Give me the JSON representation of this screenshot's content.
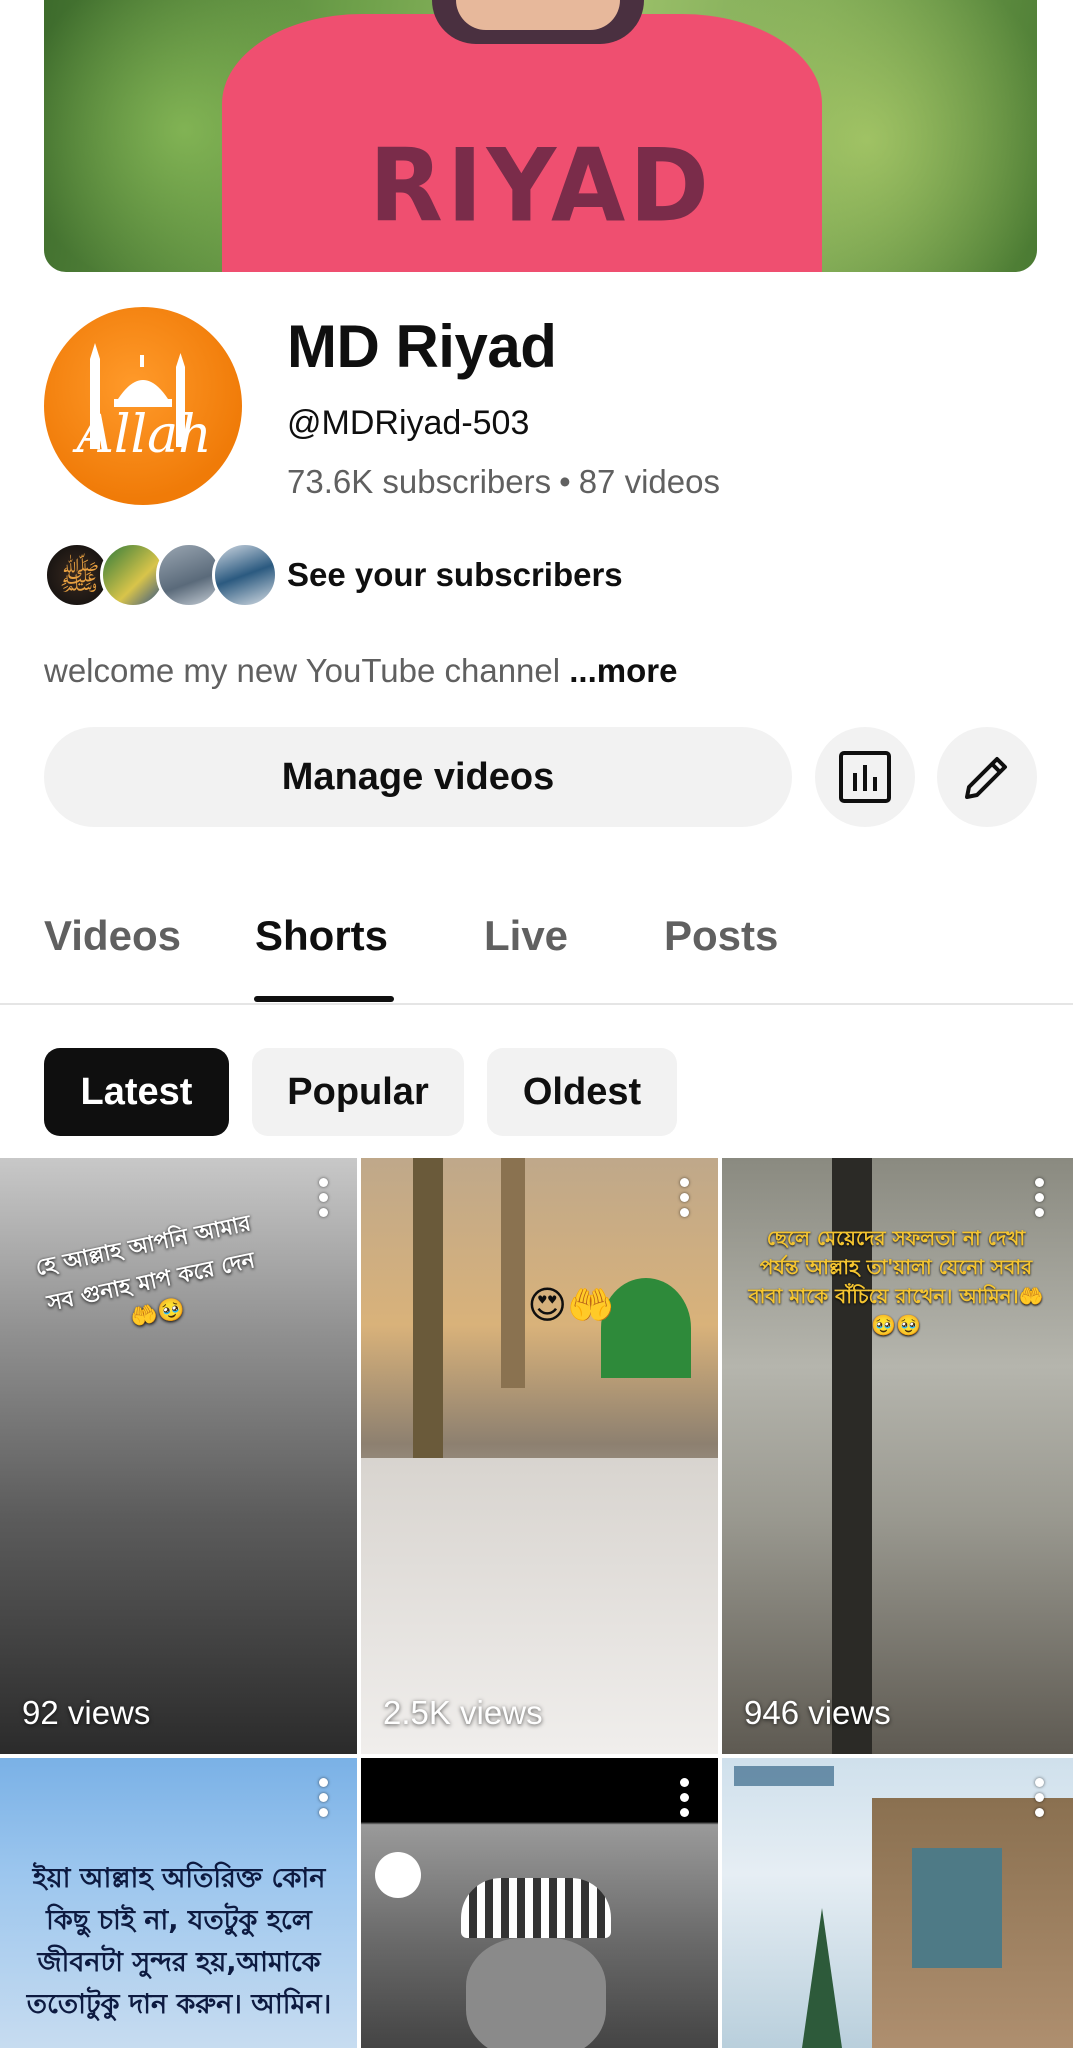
{
  "banner": {
    "shirt_text": "RIYAD"
  },
  "channel": {
    "avatar_text": "Allah",
    "name": "MD Riyad",
    "handle": "@MDRiyad-503",
    "subscribers": "73.6K subscribers",
    "separator": "•",
    "videos": "87 videos",
    "see_subscribers": "See your subscribers",
    "description": "welcome my new YouTube channel ",
    "more": "...more"
  },
  "actions": {
    "manage_videos": "Manage videos",
    "stats_icon": "analytics-icon",
    "edit_icon": "pencil-icon"
  },
  "tabs": [
    {
      "label": "Videos"
    },
    {
      "label": "Shorts",
      "selected": true
    },
    {
      "label": "Live"
    },
    {
      "label": "Posts"
    }
  ],
  "chips": [
    {
      "label": "Latest",
      "selected": true
    },
    {
      "label": "Popular"
    },
    {
      "label": "Oldest"
    }
  ],
  "shorts": [
    {
      "views": "92 views",
      "caption": "হে আল্লাহ আপনি আমার সব গুনাহ মাপ করে দেন 🤲🥹"
    },
    {
      "views": "2.5K views",
      "caption": "😍🤲"
    },
    {
      "views": "946 views",
      "caption": "ছেলে মেয়েদের সফলতা না দেখা পর্যন্ত আল্লাহ তা'য়ালা যেনো সবার বাবা মাকে বাঁচিয়ে রাখেন। আমিন।🤲🥹🥹"
    },
    {
      "views": "",
      "caption": "ইয়া আল্লাহ অতিরিক্ত কোন কিছু চাই না, যতটুকু হলে জীবনটা সুন্দর হয়,আমাকে ততোটুকু দান করুন। আমিন।"
    },
    {
      "views": "",
      "caption": ""
    },
    {
      "views": "",
      "caption": ""
    }
  ],
  "colors": {
    "accent_dark": "#0f0f0f",
    "secondary_text": "#606060",
    "chip_bg": "#f2f2f2",
    "avatar_orange": "#f07b08",
    "banner_shirt": "#ef4f70"
  }
}
